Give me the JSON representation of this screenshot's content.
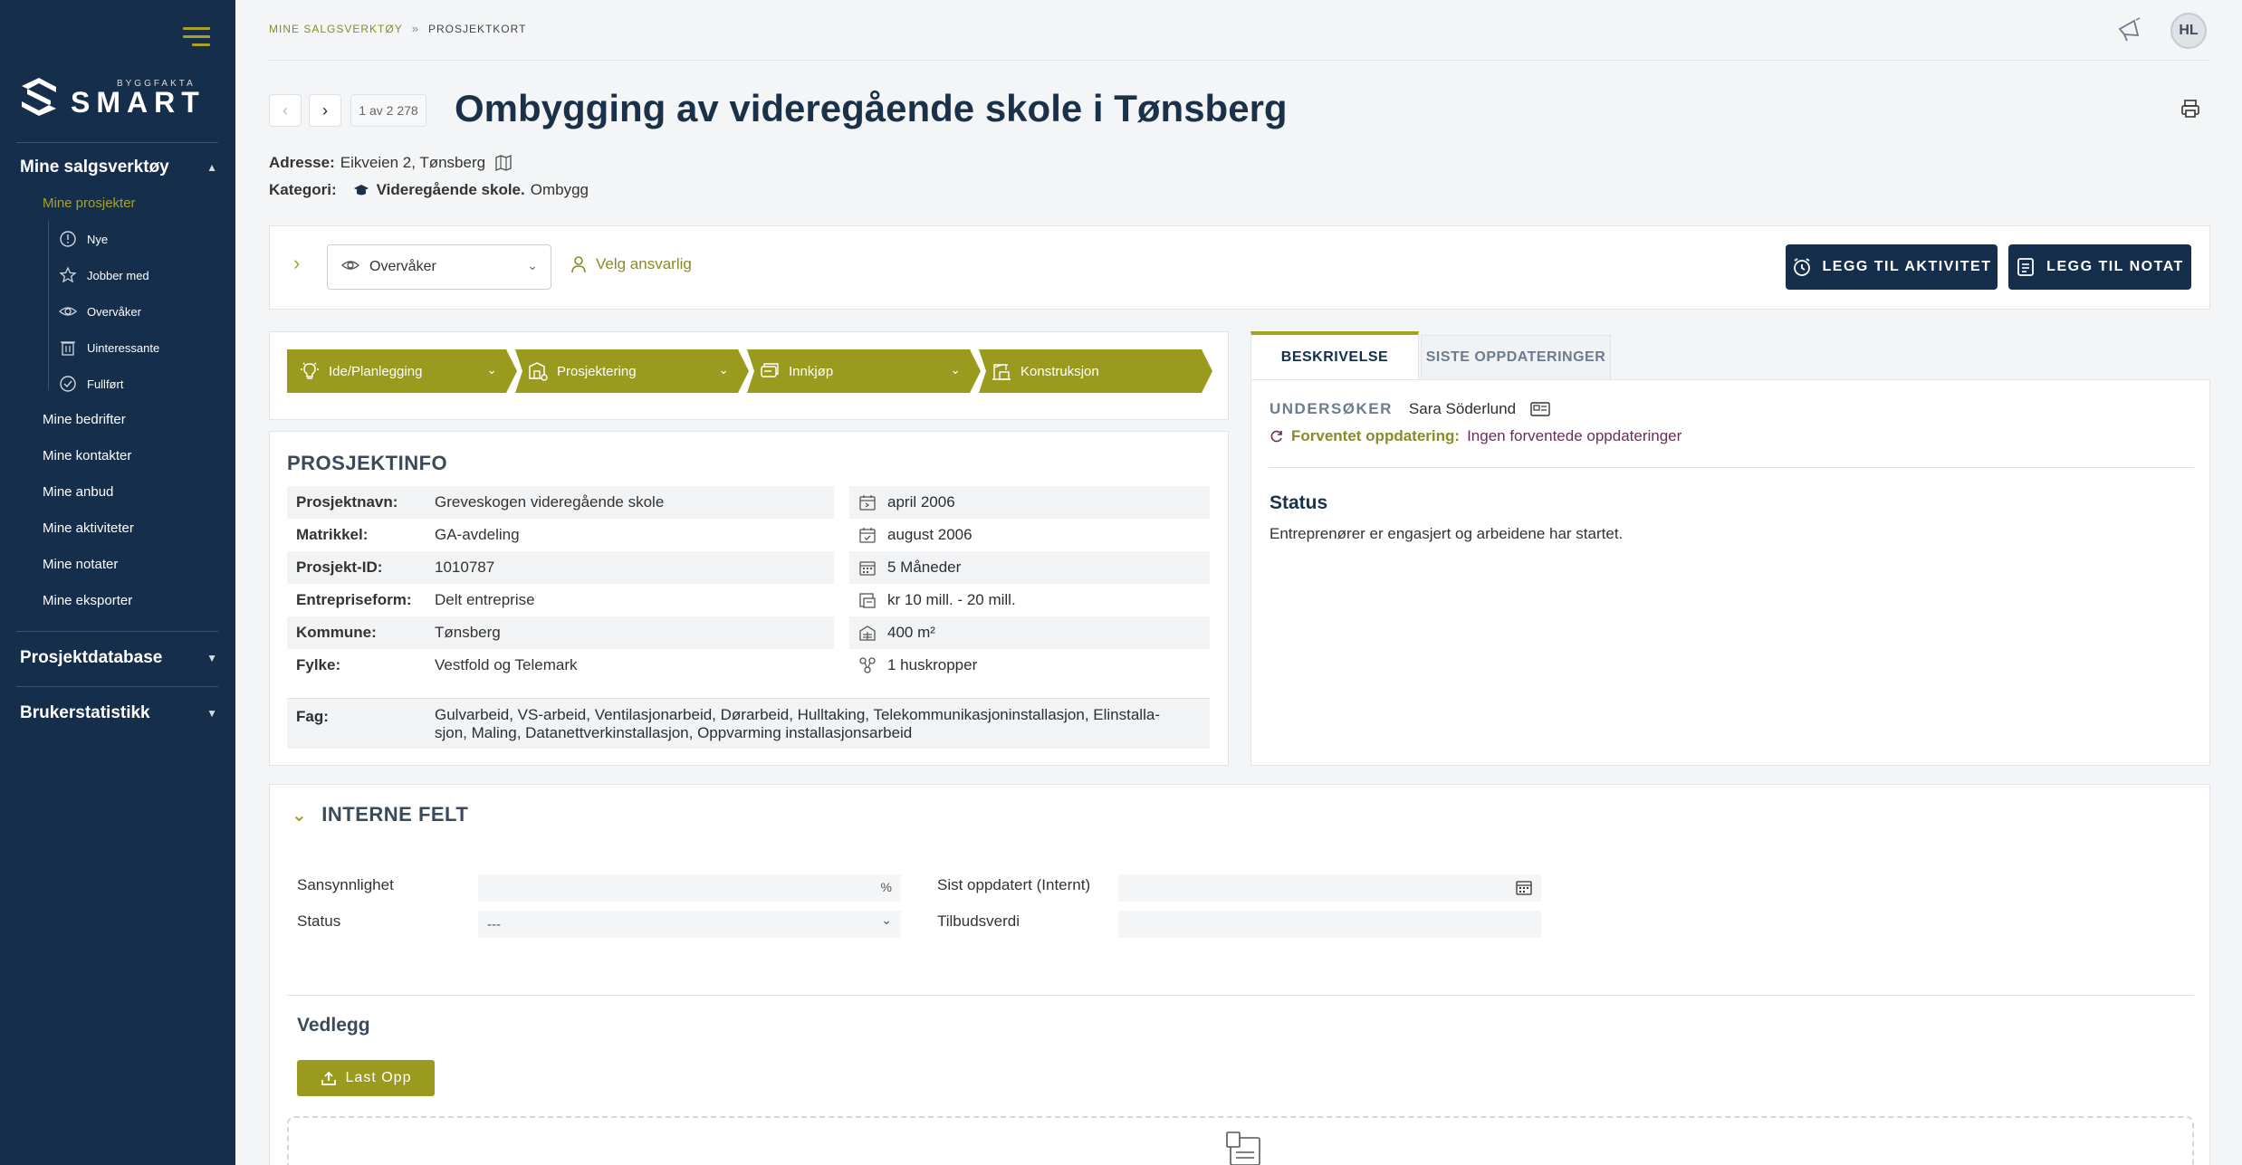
{
  "brand": {
    "small": "BYGGFAKTA",
    "big": "SMART"
  },
  "sidebar": {
    "sections": [
      {
        "label": "Mine salgsverktøy",
        "expanded": true
      },
      {
        "label": "Prosjektdatabase",
        "expanded": false
      },
      {
        "label": "Brukerstatistikk",
        "expanded": false
      }
    ],
    "active_link": "Mine prosjekter",
    "sub_items": [
      {
        "label": "Nye",
        "icon": "info-circle-icon"
      },
      {
        "label": "Jobber med",
        "icon": "star-icon"
      },
      {
        "label": "Overvåker",
        "icon": "eye-icon"
      },
      {
        "label": "Uinteressante",
        "icon": "trash-icon"
      },
      {
        "label": "Fullført",
        "icon": "check-circle-icon"
      }
    ],
    "links": [
      "Mine bedrifter",
      "Mine kontakter",
      "Mine anbud",
      "Mine aktiviteter",
      "Mine notater",
      "Mine eksporter"
    ]
  },
  "breadcrumb": {
    "parent": "MINE SALGSVERKTØY",
    "separator": "»",
    "current": "PROSJEKTKORT"
  },
  "user": {
    "initials": "HL"
  },
  "pager": {
    "text": "1 av 2 278"
  },
  "project": {
    "title": "Ombygging av videregående skole i Tønsberg",
    "address_label": "Adresse:",
    "address": "Eikveien 2, Tønsberg",
    "category_label": "Kategori:",
    "category_main": "Videregående skole.",
    "category_sub": "Ombygg"
  },
  "actions": {
    "watch_select": "Overvåker",
    "assign": "Velg ansvarlig",
    "add_activity": "LEGG TIL AKTIVITET",
    "add_note": "LEGG TIL NOTAT"
  },
  "phases": [
    {
      "label": "Ide/Planlegging",
      "icon": "lightbulb-icon",
      "has_dropdown": true
    },
    {
      "label": "Prosjektering",
      "icon": "blueprint-icon",
      "has_dropdown": true
    },
    {
      "label": "Innkjøp",
      "icon": "cart-icon",
      "has_dropdown": true
    },
    {
      "label": "Konstruksjon",
      "icon": "crane-icon",
      "has_dropdown": false
    }
  ],
  "info": {
    "title": "PROSJEKTINFO",
    "rows": [
      {
        "label": "Prosjektnavn:",
        "value": "Greveskogen videregående skole"
      },
      {
        "label": "Matrikkel:",
        "value": "GA-avdeling"
      },
      {
        "label": "Prosjekt-ID:",
        "value": "1010787"
      },
      {
        "label": "Entrepriseform:",
        "value": "Delt entreprise"
      },
      {
        "label": "Kommune:",
        "value": "Tønsberg"
      },
      {
        "label": "Fylke:",
        "value": "Vestfold og Telemark"
      }
    ],
    "right": [
      {
        "icon": "calendar-start-icon",
        "value": "april 2006"
      },
      {
        "icon": "calendar-check-icon",
        "value": "august 2006"
      },
      {
        "icon": "calendar-duration-icon",
        "value": "5 Måneder"
      },
      {
        "icon": "money-icon",
        "value": "kr 10 mill. - 20 mill."
      },
      {
        "icon": "area-icon",
        "value": "400 m²"
      },
      {
        "icon": "buildings-icon",
        "value": "1 huskropper"
      }
    ],
    "fag_label": "Fag:",
    "fag": "Gulvarbeid, VS-arbeid, Ventilasjonarbeid, Dørarbeid, Hulltaking, Telekommunikasjoninstallasjon, Elinstalla-sjon, Maling, Datanettverkinstallasjon, Oppvarming installasjonsarbeid"
  },
  "tabs": {
    "description": "BESKRIVELSE",
    "updates": "SISTE OPPDATERINGER"
  },
  "description": {
    "investigator_label": "UNDERSØKER",
    "investigator": "Sara Söderlund",
    "expected_label": "Forventet oppdatering:",
    "expected": "Ingen forventede oppdateringer",
    "status_title": "Status",
    "status_text": "Entreprenører er engasjert og arbeidene har startet."
  },
  "internal": {
    "title": "INTERNE FELT",
    "probability_label": "Sansynnlighet",
    "probability_value": "",
    "probability_suffix": "%",
    "status_label": "Status",
    "status_value": "---",
    "last_updated_label": "Sist oppdatert (Internt)",
    "last_updated_value": "",
    "offer_label": "Tilbudsverdi",
    "offer_value": "",
    "attachments_title": "Vedlegg",
    "upload_label": "Last Opp"
  },
  "colors": {
    "sidebar": "#152e4b",
    "accent": "#a6a324",
    "phase": "#9a9a1e",
    "purple": "#6b2d5a"
  }
}
